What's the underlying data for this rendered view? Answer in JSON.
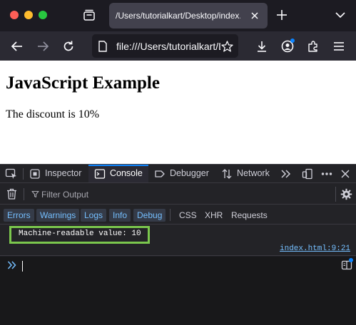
{
  "browser": {
    "tab": {
      "title": "/Users/tutorialkart/Desktop/index.html"
    },
    "url": "file:///Users/tutorialkart/Desktop/index.html"
  },
  "page": {
    "heading": "JavaScript Example",
    "paragraph": "The discount is 10%"
  },
  "devtools": {
    "tabs": [
      {
        "label": "Inspector",
        "icon": "inspector-icon"
      },
      {
        "label": "Console",
        "icon": "console-icon",
        "selected": true
      },
      {
        "label": "Debugger",
        "icon": "debugger-icon"
      },
      {
        "label": "Network",
        "icon": "network-icon"
      }
    ],
    "filter_placeholder": "Filter Output",
    "levels": [
      "Errors",
      "Warnings",
      "Logs",
      "Info",
      "Debug"
    ],
    "categories": [
      "CSS",
      "XHR",
      "Requests"
    ],
    "messages": [
      {
        "text": "Machine-readable value: 10",
        "source": "index.html:9:21"
      }
    ]
  },
  "colors": {
    "highlight": "#7bc74d",
    "accent": "#0b84ff",
    "link": "#75bfff"
  }
}
